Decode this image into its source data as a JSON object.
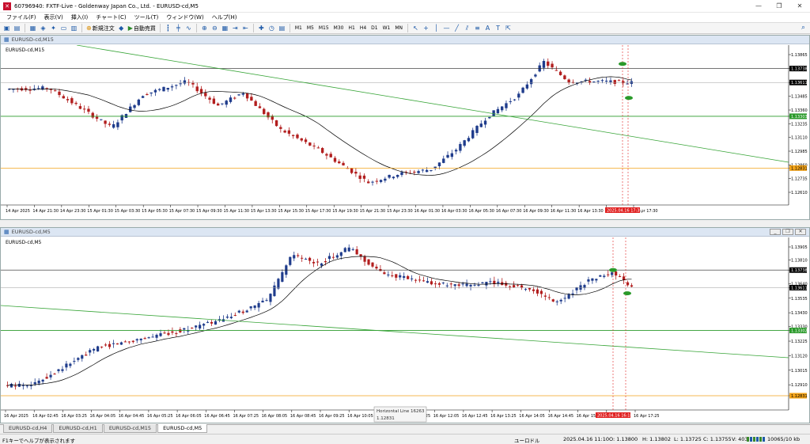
{
  "app": {
    "title": "60796940: FXTF-Live - Goldenway Japan Co., Ltd. - EURUSD-cd,M5",
    "icon": "app-logo-icon"
  },
  "menu": [
    "ファイル(F)",
    "表示(V)",
    "挿入(I)",
    "チャート(C)",
    "ツール(T)",
    "ウィンドウ(W)",
    "ヘルプ(H)"
  ],
  "toolbar": {
    "new_order": "新規注文",
    "auto_trade": "自動売買",
    "timeframes": [
      "M1",
      "M5",
      "M15",
      "M30",
      "H1",
      "H4",
      "D1",
      "W1",
      "MN"
    ]
  },
  "top_chart": {
    "window_title": "EURUSD-cd,M15",
    "label": "EURUSD-cd,M15",
    "price_labels": [
      "1.13865",
      "1.13738",
      "1.13611",
      "1.13485",
      "1.13360",
      "1.13303",
      "1.13235",
      "1.13110",
      "1.12985",
      "1.12860",
      "1.12831",
      "1.12735",
      "1.12610"
    ],
    "highlight_labels": {
      "h_line_upper": "1.13738",
      "current": "1.13611",
      "h_line_green": "1.13303",
      "h_line_orange": "1.12831"
    },
    "time_labels": [
      "14 Apr 2025",
      "14 Apr 21:30",
      "14 Apr 23:30",
      "15 Apr 01:30",
      "15 Apr 03:30",
      "15 Apr 05:30",
      "15 Apr 07:30",
      "15 Apr 09:30",
      "15 Apr 11:30",
      "15 Apr 13:30",
      "15 Apr 15:30",
      "15 Apr 17:30",
      "15 Apr 19:30",
      "15 Apr 21:30",
      "15 Apr 23:30",
      "16 Apr 01:30",
      "16 Apr 03:30",
      "16 Apr 05:30",
      "16 Apr 07:30",
      "16 Apr 09:30",
      "16 Apr 11:30",
      "16 Apr 13:30",
      "16 Apr 15:30",
      "16 Apr 17:30"
    ],
    "time_marker": "2025.04.16 17:30"
  },
  "bottom_chart": {
    "window_title": "EURUSD-cd,M5",
    "label": "EURUSD-cd,M5",
    "price_labels": [
      "1.13905",
      "1.13810",
      "1.13738",
      "1.13640",
      "1.13611",
      "1.13535",
      "1.13430",
      "1.13330",
      "1.13302",
      "1.13225",
      "1.13120",
      "1.13015",
      "1.12910",
      "1.12831"
    ],
    "highlight_labels": {
      "h_line_upper": "1.13738",
      "current": "1.13611",
      "h_line_green": "1.13302",
      "h_line_orange": "1.12831"
    },
    "time_labels": [
      "16 Apr 2025",
      "16 Apr 02:45",
      "16 Apr 03:25",
      "16 Apr 04:05",
      "16 Apr 04:45",
      "16 Apr 05:25",
      "16 Apr 06:05",
      "16 Apr 06:45",
      "16 Apr 07:25",
      "16 Apr 08:05",
      "16 Apr 08:45",
      "16 Apr 09:25",
      "16 Apr 10:05",
      "16 Apr 10:45",
      "16 Apr 11:25",
      "16 Apr 12:05",
      "16 Apr 12:45",
      "16 Apr 13:25",
      "16 Apr 14:05",
      "16 Apr 14:45",
      "16 Apr 15:25",
      "16 Apr 16:05",
      "16 Apr 17:25"
    ],
    "time_marker": "2025.04.16 16:10",
    "tooltip": {
      "name": "Horizontal Line 16263",
      "value": "1.12831"
    }
  },
  "tabs": [
    "EURUSD-cd,H4",
    "EURUSD-cd,H1",
    "EURUSD-cd,M15",
    "EURUSD-cd,M5"
  ],
  "active_tab": "EURUSD-cd,M5",
  "status": {
    "help": "F1キーでヘルプが表示されます",
    "profile": "ユーロドル",
    "datetime": "2025.04.16 11:10",
    "open": "O: 1.13800",
    "high": "H: 1.13802",
    "low": "L: 1.13725",
    "close": "C: 1.13755",
    "volume": "V: 403",
    "traffic": "10065/10 kb"
  },
  "colors": {
    "bull": "#1f3c8c",
    "bear": "#b21e1e",
    "ma": "#000000",
    "trendline": "#36a436",
    "support_green": "#2a9a2a",
    "support_orange": "#f2a31a",
    "resistance_black": "#222222",
    "marker_red": "#e02020"
  }
}
